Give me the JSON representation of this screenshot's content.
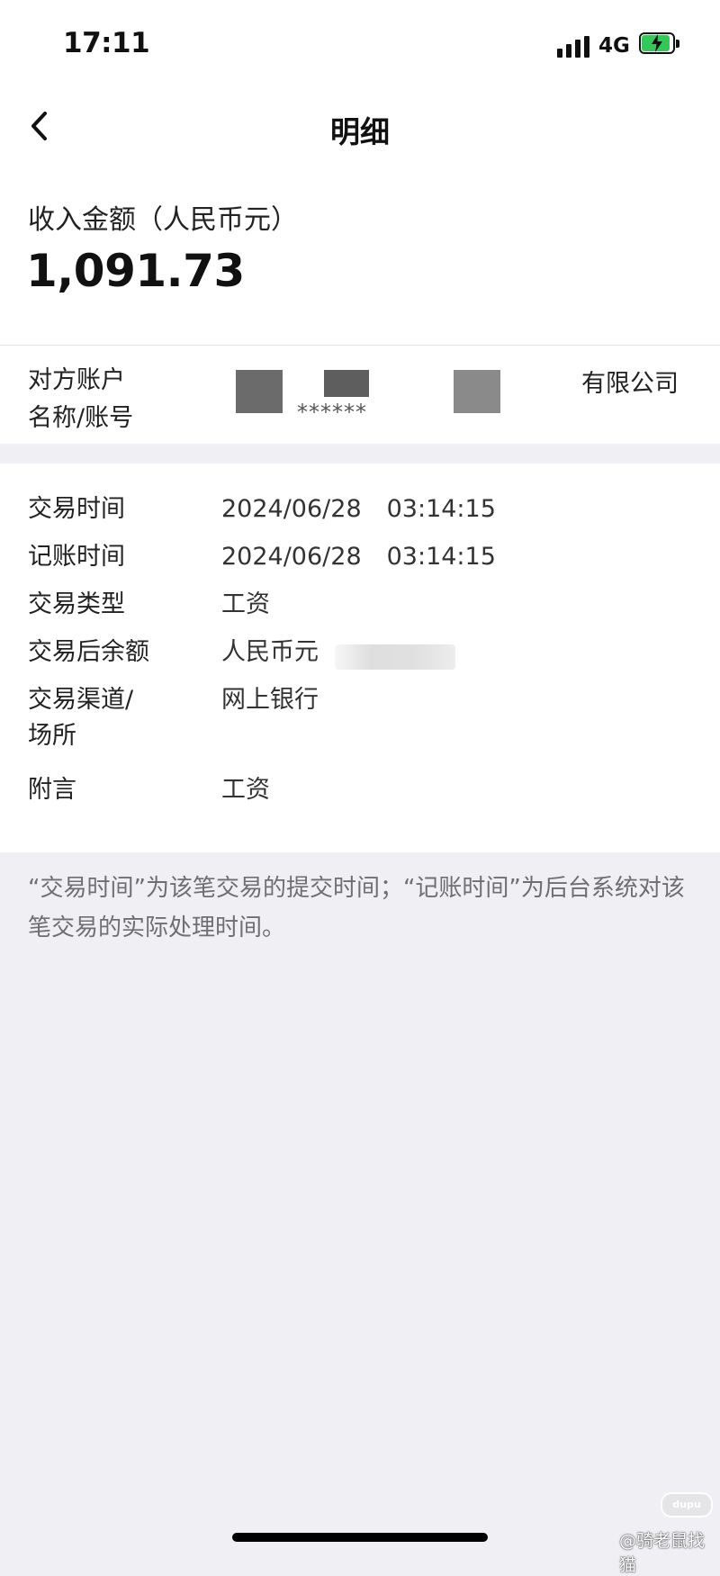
{
  "status_bar": {
    "time": "17:11",
    "network": "4G",
    "battery_level": 0.9,
    "battery_charging": true,
    "battery_color": "#34c759"
  },
  "nav": {
    "back_icon": "chevron-left-icon",
    "title": "明细"
  },
  "amount": {
    "label": "收入金额（人民币元）",
    "value": "1,091.73"
  },
  "counterparty": {
    "label_line1": "对方账户",
    "label_line2": "名称/账号",
    "masked_account": "******",
    "name_suffix": "有限公司"
  },
  "details": [
    {
      "label": "交易时间",
      "date": "2024/06/28",
      "time": "03:14:15"
    },
    {
      "label": "记账时间",
      "date": "2024/06/28",
      "time": "03:14:15"
    },
    {
      "label": "交易类型",
      "value": "工资"
    },
    {
      "label": "交易后余额",
      "value": "人民币元"
    },
    {
      "label_line1": "交易渠道/",
      "label_line2": "场所",
      "value": "网上银行"
    },
    {
      "label": "附言",
      "value": "工资"
    }
  ],
  "footnote": "“交易时间”为该笔交易的提交时间；“记账时间”为后台系统对该笔交易的实际处理时间。",
  "watermark": {
    "logo_text": "dupu",
    "handle": "@骑老鼠找猫"
  }
}
